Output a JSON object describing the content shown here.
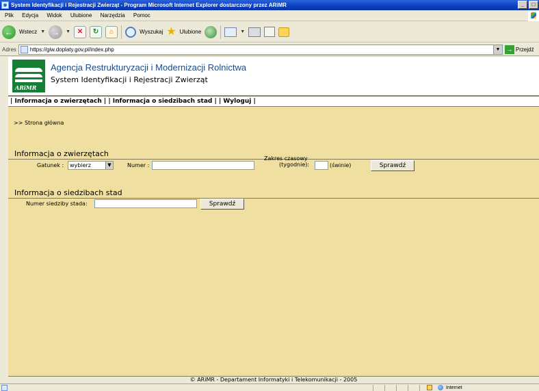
{
  "window": {
    "title": "System Identyfikacji i Rejestracji Zwierząt - Program Microsoft Internet Explorer dostarczony przez ARiMR"
  },
  "menu": [
    "Plik",
    "Edycja",
    "Widok",
    "Ulubione",
    "Narzędzia",
    "Pomoc"
  ],
  "toolbar": {
    "back_label": "Wstecz",
    "search_label": "Wyszukaj",
    "favorites_label": "Ulubione"
  },
  "address": {
    "label": "Adres",
    "url": "https://giw.doplaty.gov.pl/index.php",
    "go_label": "Przejdź"
  },
  "header": {
    "logo_text": "ARiMR",
    "agency": "Agencja Restrukturyzacji i Modernizacji Rolnictwa",
    "system": "System Identyfikacji i Rejestracji Zwierząt"
  },
  "nav": {
    "item1": "Informacja o zwierzętach",
    "item2": "Informacja o siedzibach stad",
    "item3": "Wyloguj",
    "sep": "|"
  },
  "breadcrumb": ">> Strona główna",
  "animals": {
    "title": "Informacja o zwierzętach",
    "species_label": "Gatunek :",
    "species_value": "wybierz",
    "number_label": "Numer :",
    "number_value": "",
    "range_label1": "Zakres czasowy",
    "range_label2": "(tygodnie):",
    "range_value": "",
    "range_unit": "(świnie)",
    "submit": "Sprawdź"
  },
  "herds": {
    "title": "Informacja o siedzibach stad",
    "number_label": "Numer siedziby stada:",
    "number_value": "",
    "submit": "Sprawdź"
  },
  "footer": "© ARiMR - Departament Informatyki i Telekomunikacji - 2005",
  "status": {
    "zone": "Internet"
  }
}
